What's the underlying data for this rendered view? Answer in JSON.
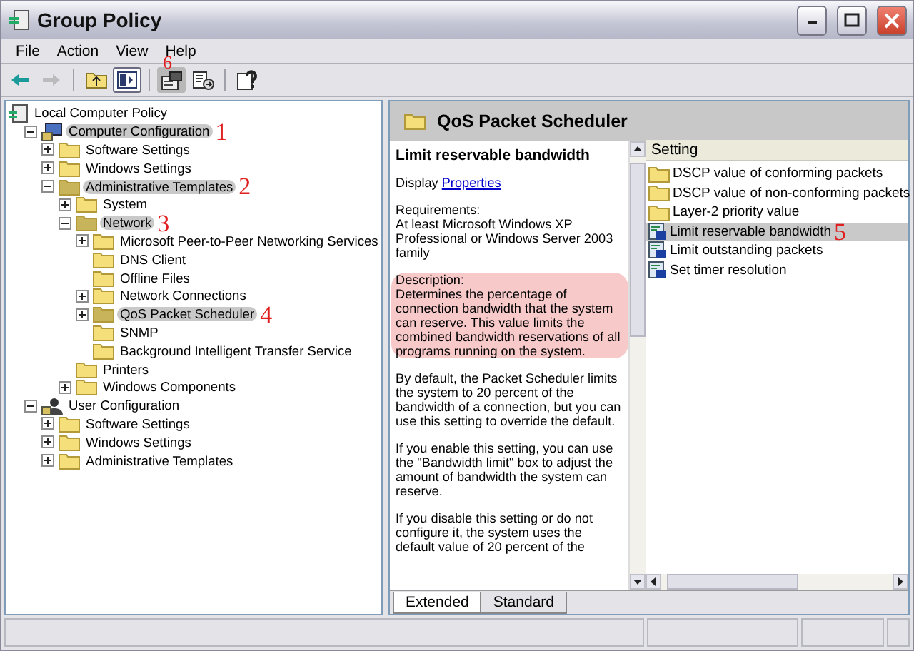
{
  "window": {
    "title": "Group Policy"
  },
  "menu": [
    "File",
    "Action",
    "View",
    "Help"
  ],
  "toolbar": {
    "groups": [
      [
        {
          "disabled": false,
          "pressed": false,
          "highlighted": false
        },
        {
          "disabled": true,
          "pressed": false,
          "highlighted": false
        }
      ],
      [
        {
          "disabled": false,
          "pressed": false,
          "highlighted": false
        },
        {
          "disabled": false,
          "pressed": true,
          "highlighted": false
        }
      ],
      [
        {
          "disabled": false,
          "pressed": false,
          "highlighted": true,
          "callout": "6"
        },
        {
          "disabled": false,
          "pressed": false,
          "highlighted": false
        }
      ],
      [
        {
          "disabled": false,
          "pressed": false,
          "highlighted": false
        }
      ]
    ]
  },
  "tree": [
    {
      "label": "Local Computer Policy",
      "kind": "policy",
      "highlighted": false,
      "children": [
        {
          "label": "Computer Configuration",
          "kind": "computer",
          "expanded": true,
          "highlighted": true,
          "callout": "1",
          "children": [
            {
              "label": "Software Settings",
              "kind": "folder",
              "expanded": false,
              "highlighted": false
            },
            {
              "label": "Windows Settings",
              "kind": "folder",
              "expanded": false,
              "highlighted": false
            },
            {
              "label": "Administrative Templates",
              "kind": "folder",
              "expanded": true,
              "highlighted": true,
              "callout": "2",
              "children": [
                {
                  "label": "System",
                  "kind": "folder",
                  "expanded": false,
                  "highlighted": false
                },
                {
                  "label": "Network",
                  "kind": "folder",
                  "expanded": true,
                  "highlighted": true,
                  "callout": "3",
                  "children": [
                    {
                      "label": "Microsoft Peer-to-Peer Networking Services",
                      "kind": "folder",
                      "expanded": false,
                      "highlighted": false
                    },
                    {
                      "label": "DNS Client",
                      "kind": "folder",
                      "highlighted": false
                    },
                    {
                      "label": "Offline Files",
                      "kind": "folder",
                      "highlighted": false
                    },
                    {
                      "label": "Network Connections",
                      "kind": "folder",
                      "expanded": false,
                      "highlighted": false
                    },
                    {
                      "label": "QoS Packet Scheduler",
                      "kind": "folder",
                      "expanded": false,
                      "highlighted": true,
                      "callout": "4"
                    },
                    {
                      "label": "SNMP",
                      "kind": "folder",
                      "highlighted": false
                    },
                    {
                      "label": "Background Intelligent Transfer Service",
                      "kind": "folder",
                      "highlighted": false
                    }
                  ]
                },
                {
                  "label": "Printers",
                  "kind": "folder",
                  "highlighted": false
                },
                {
                  "label": "Windows Components",
                  "kind": "folder",
                  "expanded": false,
                  "highlighted": false
                }
              ]
            }
          ]
        },
        {
          "label": "User Configuration",
          "kind": "user",
          "expanded": true,
          "highlighted": false,
          "children": [
            {
              "label": "Software Settings",
              "kind": "folder",
              "expanded": false,
              "highlighted": false
            },
            {
              "label": "Windows Settings",
              "kind": "folder",
              "expanded": false,
              "highlighted": false
            },
            {
              "label": "Administrative Templates",
              "kind": "folder",
              "expanded": false,
              "highlighted": false
            }
          ]
        }
      ]
    }
  ],
  "details": {
    "header": "QoS Packet Scheduler",
    "title": "Limit reservable bandwidth",
    "display_label": "Display",
    "display_link": "Properties",
    "paragraphs": [
      {
        "text": "Requirements:\nAt least Microsoft Windows XP Professional or Windows Server 2003 family",
        "highlighted": false
      },
      {
        "text": "Description:\nDetermines the percentage of connection bandwidth that the system can reserve. This value limits the combined bandwidth reservations of all programs running on the system.",
        "highlighted": true
      },
      {
        "text": "By default, the Packet Scheduler limits the system to 20 percent of the bandwidth of a connection, but you can use this setting to override the default.",
        "highlighted": false
      },
      {
        "text": "If you enable this setting, you can use the \"Bandwidth limit\" box to adjust the amount of bandwidth the system can reserve.",
        "highlighted": false
      },
      {
        "text": "If you disable this setting or do not configure it, the system uses the default value of 20 percent of the",
        "highlighted": false
      }
    ]
  },
  "settings": {
    "column": "Setting",
    "items": [
      {
        "label": "DSCP value of conforming packets",
        "kind": "folder",
        "highlighted": false
      },
      {
        "label": "DSCP value of non-conforming packets",
        "kind": "folder",
        "highlighted": false
      },
      {
        "label": "Layer-2 priority value",
        "kind": "folder",
        "highlighted": false
      },
      {
        "label": "Limit reservable bandwidth",
        "kind": "setting",
        "highlighted": true,
        "callout": "5"
      },
      {
        "label": "Limit outstanding packets",
        "kind": "setting",
        "highlighted": false
      },
      {
        "label": "Set timer resolution",
        "kind": "setting",
        "highlighted": false
      }
    ]
  },
  "tabs": [
    {
      "label": "Extended",
      "selected": true
    },
    {
      "label": "Standard",
      "selected": false
    }
  ]
}
